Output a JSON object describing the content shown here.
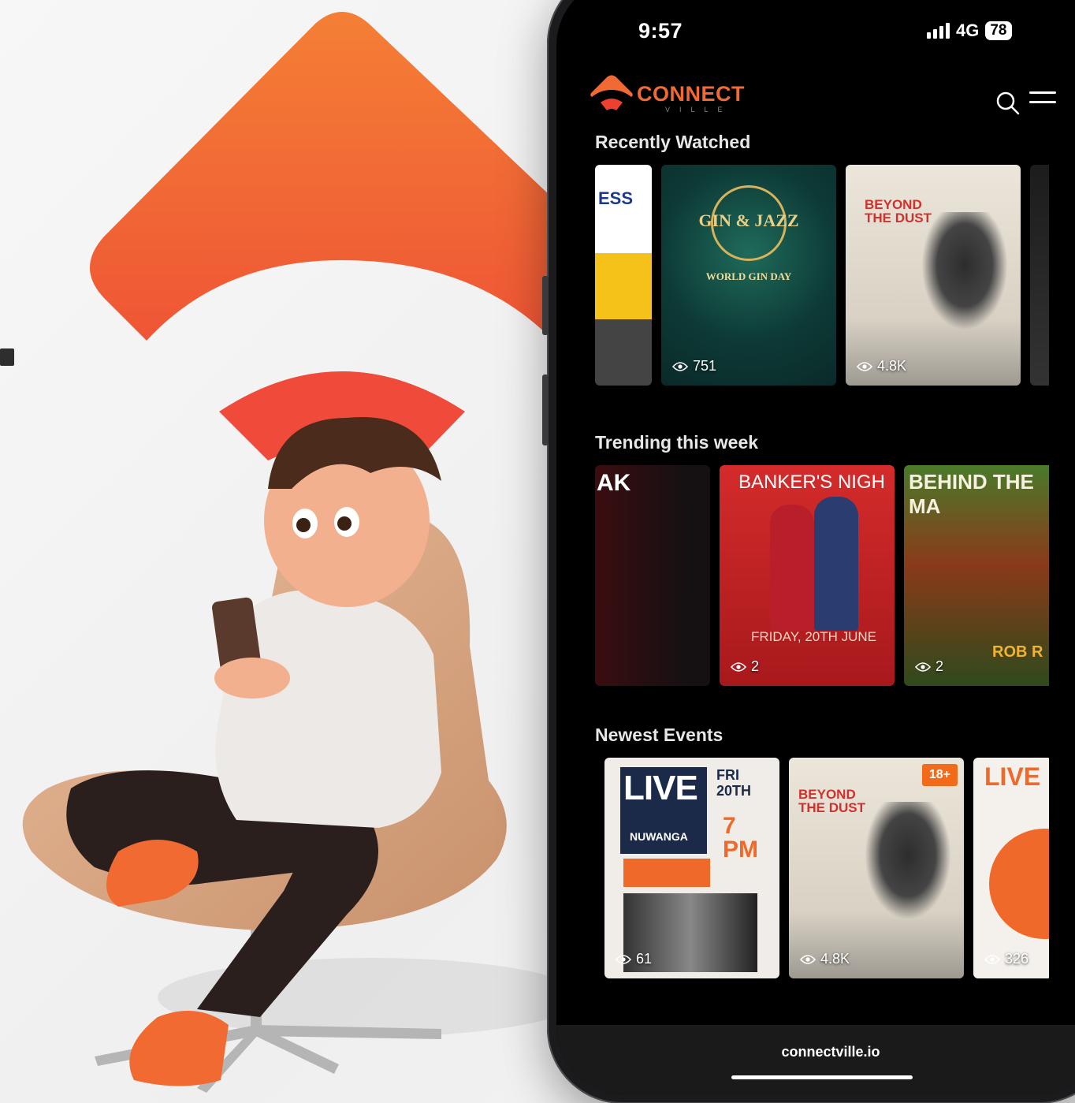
{
  "status_bar": {
    "time": "9:57",
    "network": "4G",
    "battery": "78"
  },
  "app": {
    "logo_text": "CONNECT",
    "logo_sub": "VILLE",
    "accent": "#f26a33"
  },
  "sections": [
    {
      "title": "Recently Watched",
      "cards": [
        {
          "poster_text": "ESS",
          "views": ""
        },
        {
          "poster_text": "GIN & JAZZ",
          "subtitle": "WORLD GIN DAY",
          "views": "751"
        },
        {
          "poster_text": "BEYOND THE DUST",
          "views": "4.8K"
        },
        {
          "poster_text": "",
          "views": ""
        }
      ]
    },
    {
      "title": "Trending this week",
      "cards": [
        {
          "poster_text": "AK",
          "views": ""
        },
        {
          "poster_text": "BANKER'S NIGH",
          "subtitle": "FRIDAY, 20TH JUNE",
          "views": "2"
        },
        {
          "poster_text": "BEHIND THE MA",
          "subtitle": "ROB R",
          "views": "2"
        }
      ]
    },
    {
      "title": "Newest Events",
      "cards": [
        {
          "poster_text": "LIVE",
          "subtitle": "NUWANGA",
          "date": "FRI 20TH",
          "time": "7 PM",
          "views": "61"
        },
        {
          "poster_text": "BEYOND THE DUST",
          "badge": "18+",
          "views": "4.8K"
        },
        {
          "poster_text": "LIVE",
          "views": "326"
        }
      ]
    }
  ],
  "footer": {
    "url": "connectville.io"
  },
  "icons": [
    "search-icon",
    "menu-icon",
    "eye-icon",
    "signal-icon",
    "battery-icon",
    "logo-icon"
  ]
}
